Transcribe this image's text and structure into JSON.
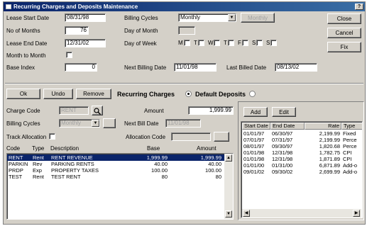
{
  "window": {
    "title": "Recurring Charges and Deposits Maintenance",
    "help_label": "?"
  },
  "lease": {
    "start_date_label": "Lease Start Date",
    "start_date": "08/31/98",
    "months_label": "No of Months",
    "months": "76",
    "end_date_label": "Lease End Date",
    "end_date": "12/31/02",
    "mtm_label": "Month to Month",
    "base_index_label": "Base Index",
    "base_index": "0"
  },
  "billing": {
    "cycle_label": "Billing Cycles",
    "cycle_value": "Monthly",
    "cycle_extra": "Monthly",
    "day_of_month_label": "Day of Month",
    "day_of_month": "",
    "day_of_week_label": "Day of Week",
    "weekdays": [
      "M",
      "T",
      "W",
      "T",
      "F",
      "S",
      "S"
    ],
    "next_billing_label": "Next Billing Date",
    "next_billing": "11/01/98",
    "last_billed_label": "Last Billed Date",
    "last_billed": "08/13/02"
  },
  "side_buttons": {
    "close": "Close",
    "cancel": "Cancel",
    "fix": "Fix"
  },
  "action_bar": {
    "ok": "Ok",
    "undo": "Undo",
    "remove": "Remove",
    "recurring_label": "Recurring Charges",
    "deposits_label": "Default Deposits"
  },
  "charge": {
    "code_label": "Charge Code",
    "code_value": "RENT",
    "amount_label": "Amount",
    "amount_value": "1,999.99",
    "cycles_label": "Billing Cycles",
    "cycles_value": "Monthly",
    "next_bill_label": "Next Bill Date",
    "next_bill_value": "11/01/98",
    "track_label": "Track Allocation",
    "alloc_label": "Allocation Code",
    "alloc_value": ""
  },
  "charges_table": {
    "headers": [
      "Code",
      "Type",
      "Description",
      "Base",
      "Amount"
    ],
    "rows": [
      [
        "RENT",
        "Rent",
        "RENT REVENUE",
        "1,999.99",
        "1,999.99"
      ],
      [
        "PARKIN",
        "Rev",
        "PARKING RENTS",
        "40.00",
        "40.00"
      ],
      [
        "PRDP",
        "Exp",
        "PROPERTY TAXES",
        "100.00",
        "100.00"
      ],
      [
        "TEST",
        "Rent",
        "TEST RENT",
        "80",
        "80"
      ]
    ]
  },
  "history": {
    "add": "Add",
    "edit": "Edit",
    "headers": [
      "Start Date",
      "End Date",
      "Rate",
      "Type"
    ],
    "rows": [
      [
        "01/01/97",
        "06/30/97",
        "2,199.99",
        "Fixed"
      ],
      [
        "07/01/97",
        "07/31/97",
        "2,199.99",
        "Perce"
      ],
      [
        "08/01/97",
        "09/30/97",
        "1,820.68",
        "Perce"
      ],
      [
        "01/01/98",
        "12/31/98",
        "1,782.75",
        "CPI"
      ],
      [
        "01/01/98",
        "12/31/98",
        "1,871.89",
        "CPI"
      ],
      [
        "01/01/00",
        "01/31/00",
        "6,871.89",
        "Add-o"
      ],
      [
        "09/01/02",
        "09/30/02",
        "2,699.99",
        "Add-o"
      ]
    ]
  }
}
